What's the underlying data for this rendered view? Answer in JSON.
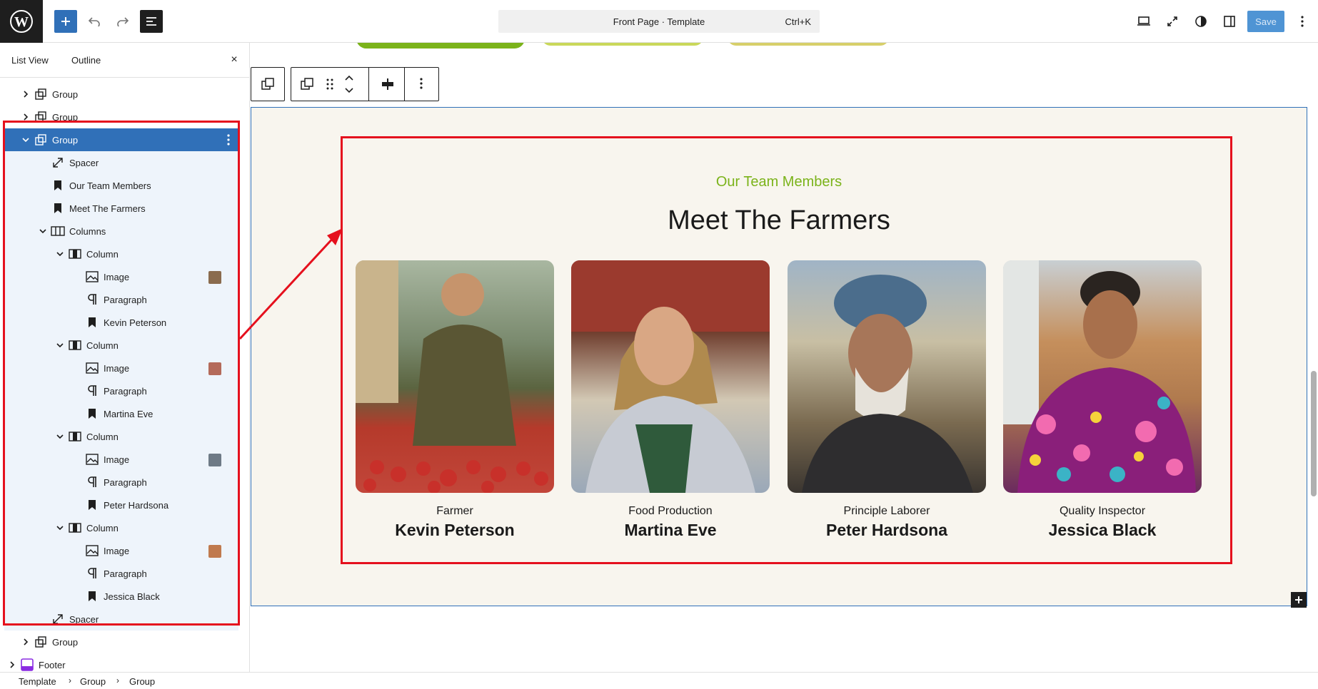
{
  "header": {
    "command_label": "Front Page · Template",
    "command_shortcut": "Ctrl+K",
    "save_label": "Save"
  },
  "sidebar": {
    "tabs": [
      {
        "label": "List View"
      },
      {
        "label": "Outline"
      }
    ],
    "close_icon": "×",
    "rows": [
      {
        "label": "Group",
        "icon": "group-icon",
        "level": 1,
        "expanded": false
      },
      {
        "label": "Group",
        "icon": "group-icon",
        "level": 1,
        "expanded": false
      },
      {
        "label": "Group",
        "icon": "group-icon",
        "level": 1,
        "expanded": true,
        "selected": true
      },
      {
        "label": "Spacer",
        "icon": "spacer-icon",
        "level": 2
      },
      {
        "label": "Our Team Members",
        "icon": "heading-bookmark-icon",
        "level": 2
      },
      {
        "label": "Meet The Farmers",
        "icon": "heading-bookmark-icon",
        "level": 2
      },
      {
        "label": "Columns",
        "icon": "columns-icon",
        "level": 2,
        "expanded": true
      },
      {
        "label": "Column",
        "icon": "column-icon",
        "level": 3,
        "expanded": true
      },
      {
        "label": "Image",
        "icon": "image-icon",
        "level": 4,
        "thumb": true
      },
      {
        "label": "Paragraph",
        "icon": "paragraph-icon",
        "level": 4
      },
      {
        "label": "Kevin Peterson",
        "icon": "heading-bookmark-icon",
        "level": 4
      },
      {
        "label": "Column",
        "icon": "column-icon",
        "level": 3,
        "expanded": true
      },
      {
        "label": "Image",
        "icon": "image-icon",
        "level": 4,
        "thumb": true
      },
      {
        "label": "Paragraph",
        "icon": "paragraph-icon",
        "level": 4
      },
      {
        "label": "Martina Eve",
        "icon": "heading-bookmark-icon",
        "level": 4
      },
      {
        "label": "Column",
        "icon": "column-icon",
        "level": 3,
        "expanded": true
      },
      {
        "label": "Image",
        "icon": "image-icon",
        "level": 4,
        "thumb": true
      },
      {
        "label": "Paragraph",
        "icon": "paragraph-icon",
        "level": 4
      },
      {
        "label": "Peter Hardsona",
        "icon": "heading-bookmark-icon",
        "level": 4
      },
      {
        "label": "Column",
        "icon": "column-icon",
        "level": 3,
        "expanded": true
      },
      {
        "label": "Image",
        "icon": "image-icon",
        "level": 4,
        "thumb": true
      },
      {
        "label": "Paragraph",
        "icon": "paragraph-icon",
        "level": 4
      },
      {
        "label": "Jessica Black",
        "icon": "heading-bookmark-icon",
        "level": 4
      },
      {
        "label": "Spacer",
        "icon": "spacer-icon",
        "level": 2
      },
      {
        "label": "Group",
        "icon": "group-icon",
        "level": 1,
        "expanded": false
      },
      {
        "label": "Footer",
        "icon": "footer-template-icon",
        "level": 0,
        "expanded": false
      }
    ]
  },
  "canvas": {
    "kicker": "Our Team Members",
    "title": "Meet The Farmers",
    "members": [
      {
        "role": "Farmer",
        "name": "Kevin Peterson"
      },
      {
        "role": "Food Production",
        "name": "Martina Eve"
      },
      {
        "role": "Principle Laborer",
        "name": "Peter Hardsona"
      },
      {
        "role": "Quality Inspector",
        "name": "Jessica Black"
      }
    ]
  },
  "breadcrumbs": [
    "Template",
    "Group",
    "Group"
  ],
  "colors": {
    "accent": "#3070b8",
    "kicker_green": "#7bb31a",
    "annotation_red": "#e5101d",
    "section_bg": "#f8f5ee"
  }
}
